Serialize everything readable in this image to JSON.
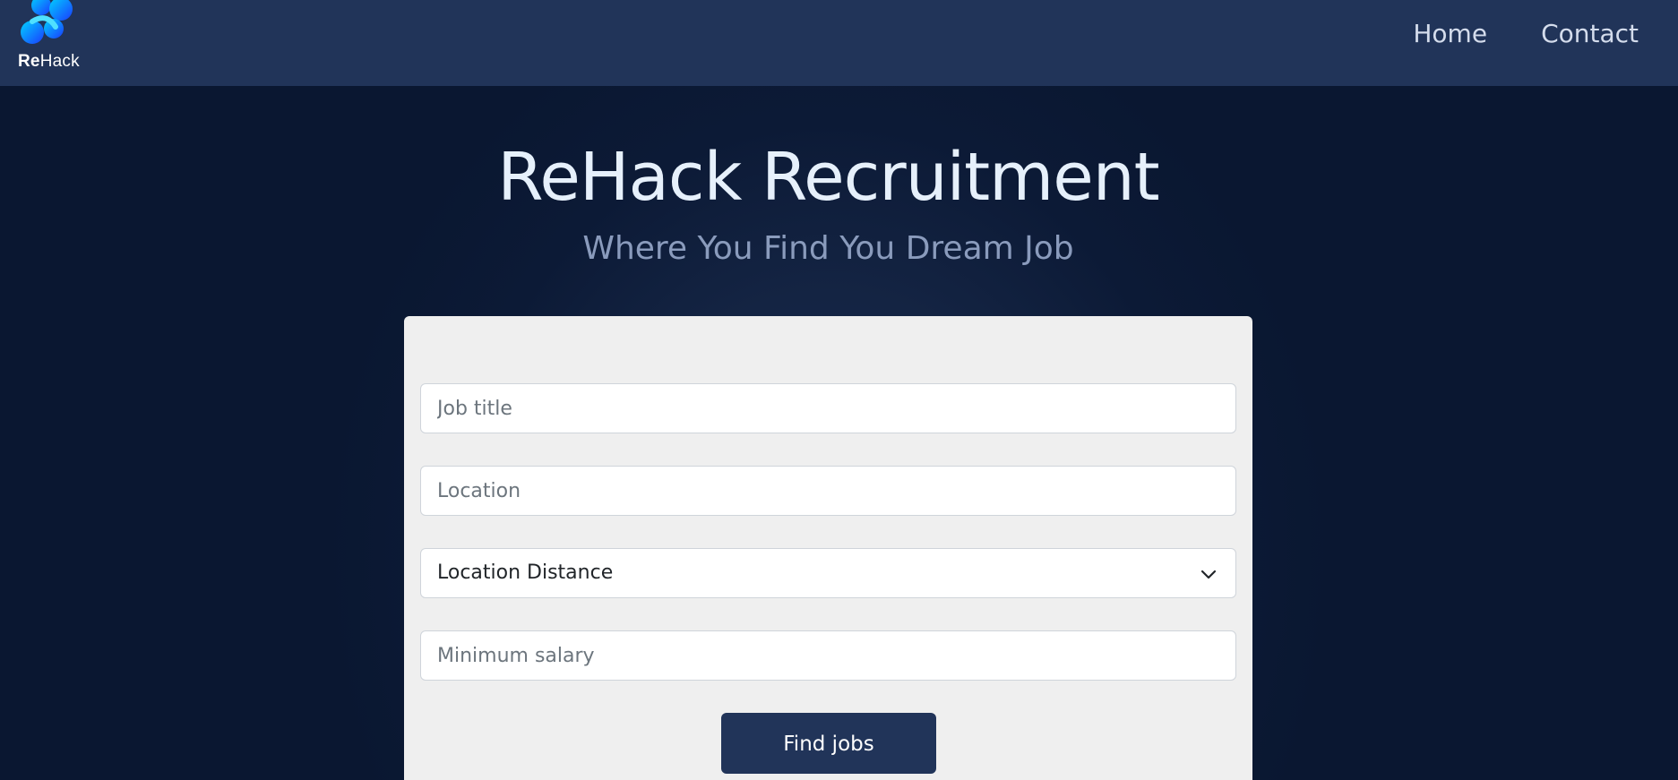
{
  "nav": {
    "logo": {
      "text_bold": "Re",
      "text_regular": "Hack",
      "icon": "rehack-logo-icon",
      "colors": [
        "#00c6ff",
        "#0066ff",
        "#1a1aff"
      ]
    },
    "links": [
      "Home",
      "Contact"
    ]
  },
  "hero": {
    "title": "ReHack Recruitment",
    "subtitle": "Where You Find You Dream Job"
  },
  "form": {
    "job_title_placeholder": "Job title",
    "location_placeholder": "Location",
    "distance_select_value": "Location Distance",
    "salary_placeholder": "Minimum salary",
    "submit_label": "Find jobs"
  },
  "colors": {
    "navbar_bg": "#213459",
    "page_bg": "#0b1833",
    "card_bg": "#efefef",
    "button_bg": "#213459",
    "title": "#e6f0fb",
    "subtitle": "#8a9bbc"
  }
}
